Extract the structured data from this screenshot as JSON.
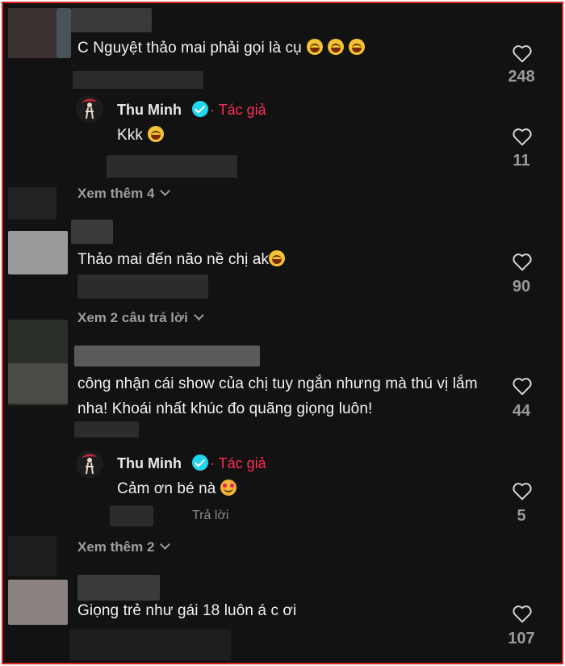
{
  "comments": [
    {
      "text": "C Nguyệt thảo mai phải gọi là cụ",
      "likes": "248",
      "replies": [
        {
          "author": "Thu Minh",
          "badge": "· Tác giả",
          "text": "Kkk",
          "likes": "11"
        }
      ],
      "view_more": "Xem thêm 4"
    },
    {
      "text": "Thảo mai đến não nề chị ak",
      "likes": "90",
      "view_more": "Xem 2 câu trả lời"
    },
    {
      "text": "công nhận cái show của chị tuy ngắn nhưng mà thú vị lắm nha! Khoái nhất khúc đo quãng giọng luôn!",
      "likes": "44",
      "replies": [
        {
          "author": "Thu Minh",
          "badge": "· Tác giả",
          "text": "Cảm ơn bé nà",
          "likes": "5",
          "reply_label": "Trả lời"
        }
      ],
      "view_more": "Xem thêm 2"
    },
    {
      "text": "Giọng trẻ như gái 18 luôn á c ơi",
      "likes": "107"
    }
  ],
  "icons": {
    "like": "heart-outline-icon",
    "verified": "verified-badge-icon",
    "expand": "chevron-down-icon"
  },
  "colors": {
    "background": "#121212",
    "author_tag": "#fe2c55",
    "verified": "#20d5ec",
    "border": "#e02020"
  }
}
